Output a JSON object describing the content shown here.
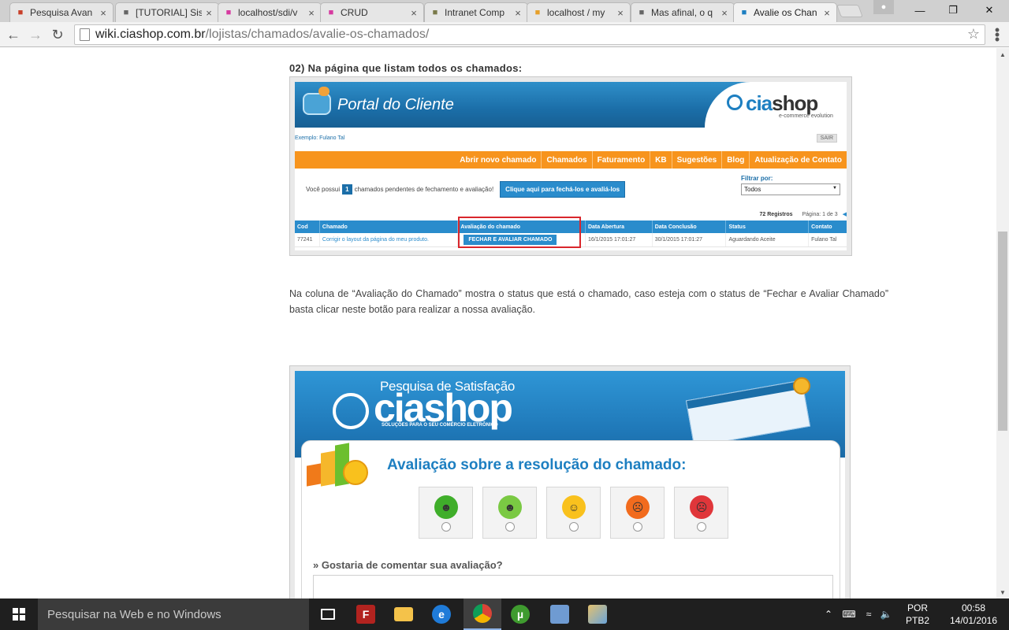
{
  "browser": {
    "tabs": [
      {
        "label": "Pesquisa Avan",
        "icon": "y-icon",
        "color": "#c8402a",
        "active": false
      },
      {
        "label": "[TUTORIAL] Sis",
        "icon": "page-icon",
        "color": "#666666",
        "active": false
      },
      {
        "label": "localhost/sdi/v",
        "icon": "wamp-icon",
        "color": "#d63aa0",
        "active": false
      },
      {
        "label": "CRUD",
        "icon": "wamp-icon",
        "color": "#d63aa0",
        "active": false
      },
      {
        "label": "Intranet Comp",
        "icon": "intranet-icon",
        "color": "#7a7a4a",
        "active": false
      },
      {
        "label": "localhost / my",
        "icon": "pma-icon",
        "color": "#e6a02a",
        "active": false
      },
      {
        "label": "Mas afinal, o q",
        "icon": "page-icon",
        "color": "#666666",
        "active": false
      },
      {
        "label": "Avalie os Chan",
        "icon": "ciashop-icon",
        "color": "#1d7fc1",
        "active": true
      }
    ],
    "url_host": "wiki.ciashop.com.br",
    "url_path": "/lojistas/chamados/avalie-os-chamados/"
  },
  "page": {
    "step_heading": "02) Na página que listam todos os chamados:",
    "portal": {
      "title": "Portal do Cliente",
      "brand_cia": "cia",
      "brand_shop": "shop",
      "tagline": "e-commerce evolution",
      "example_user": "Exemplo: Fulano Tal",
      "logout": "SAIR",
      "nav": [
        "Abrir novo chamado",
        "Chamados",
        "Faturamento",
        "KB",
        "Sugestões",
        "Blog",
        "Atualização de Contato"
      ],
      "pending_prefix": "Você possui",
      "pending_count": "1",
      "pending_suffix": "chamados pendentes de fechamento e avaliação!",
      "pending_button": "Clique aqui para fechá-los e avaliá-los",
      "filter_label": "Filtrar por:",
      "filter_value": "Todos",
      "records_count": "72 Registros",
      "page_label": "Página: 1 de 3",
      "columns": [
        "Cod",
        "Chamado",
        "Avaliação do chamado",
        "Data Abertura",
        "Data Conclusão",
        "Status",
        "Contato"
      ],
      "row": {
        "cod": "77241",
        "chamado": "Corrigir o layout da página do meu produto.",
        "action": "FECHAR E AVALIAR CHAMADO",
        "data_abertura": "16/1/2015 17:01:27",
        "data_conclusao": "30/1/2015 17:01:27",
        "status": "Aguardando Aceite",
        "contato": "Fulano Tal"
      },
      "highlight_color": "#d9262c"
    },
    "description": "Na coluna de “Avaliação do Chamado” mostra o status que está o chamado, caso esteja com o status de “Fechar e Avaliar Chamado” basta clicar neste botão para realizar a nossa avaliação.",
    "survey": {
      "subtitle": "Pesquisa de Satisfação",
      "brand": "ciashop",
      "tagline": "SOLUÇÕES PARA O SEU COMÉRCIO ELETRÔNICO",
      "question": "Avaliação sobre a resolução do chamado:",
      "faces": [
        {
          "name": "very-happy-face-icon",
          "color": "#3fae2a"
        },
        {
          "name": "happy-face-icon",
          "color": "#7ac943"
        },
        {
          "name": "neutral-face-icon",
          "color": "#f9c11d"
        },
        {
          "name": "sad-face-icon",
          "color": "#f26b1d"
        },
        {
          "name": "very-sad-face-icon",
          "color": "#e0363a"
        }
      ],
      "comment_label": "» Gostaria de comentar sua avaliação?"
    }
  },
  "taskbar": {
    "search_placeholder": "Pesquisar na Web e no Windows",
    "lang_top": "POR",
    "lang_bottom": "PTB2",
    "time": "00:58",
    "date": "14/01/2016"
  }
}
